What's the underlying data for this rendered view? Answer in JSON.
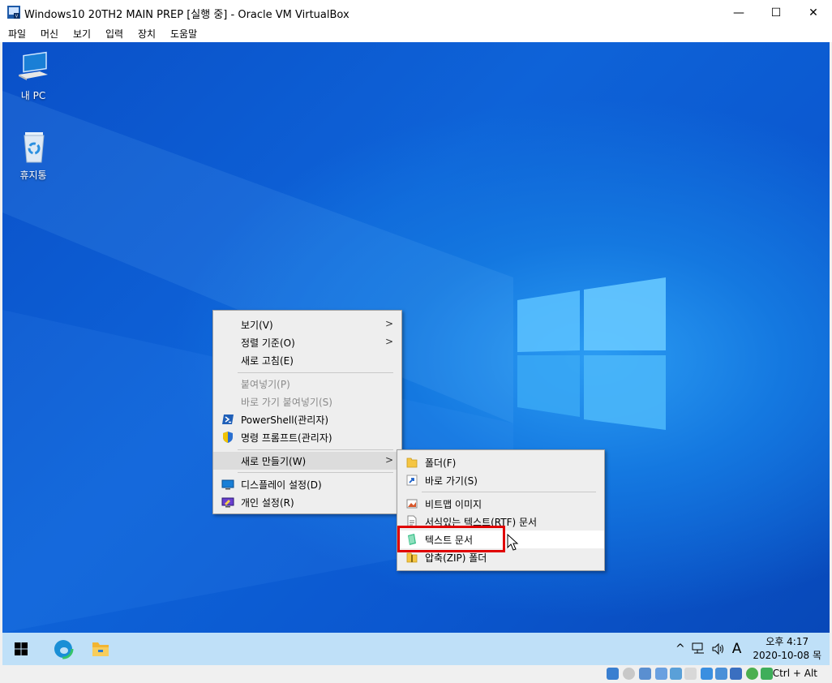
{
  "window": {
    "title": "Windows10 20TH2 MAIN PREP [실행 중] - Oracle VM VirtualBox",
    "minimize_glyph": "—",
    "maximize_glyph": "☐",
    "close_glyph": "✕"
  },
  "menubar": {
    "items": [
      "파일",
      "머신",
      "보기",
      "입력",
      "장치",
      "도움말"
    ]
  },
  "desktop": {
    "icons": [
      {
        "label": "내 PC",
        "icon": "this-pc-icon"
      },
      {
        "label": "휴지통",
        "icon": "recycle-bin-icon"
      }
    ]
  },
  "context_menu": {
    "items": [
      {
        "label": "보기(V)",
        "submenu": true,
        "disabled": false
      },
      {
        "label": "정렬 기준(O)",
        "submenu": true,
        "disabled": false
      },
      {
        "label": "새로 고침(E)",
        "submenu": false,
        "disabled": false
      },
      {
        "label": "붙여넣기(P)",
        "submenu": false,
        "disabled": true
      },
      {
        "label": "바로 가기 붙여넣기(S)",
        "submenu": false,
        "disabled": true
      },
      {
        "label": "PowerShell(관리자)",
        "icon": "powershell-icon",
        "disabled": false
      },
      {
        "label": "명령 프롬프트(관리자)",
        "icon": "shield-icon",
        "disabled": false
      },
      {
        "label": "새로 만들기(W)",
        "submenu": true,
        "disabled": false,
        "highlighted": true
      },
      {
        "label": "디스플레이 설정(D)",
        "icon": "display-icon",
        "disabled": false
      },
      {
        "label": "개인 설정(R)",
        "icon": "personalize-icon",
        "disabled": false
      }
    ],
    "submenu_arrow": ">"
  },
  "new_submenu": {
    "items": [
      {
        "label": "폴더(F)",
        "icon": "folder-icon"
      },
      {
        "label": "바로 가기(S)",
        "icon": "shortcut-icon"
      },
      {
        "label": "비트맵 이미지",
        "icon": "bitmap-icon"
      },
      {
        "label": "서식있는 텍스트(RTF) 문서",
        "icon": "rtf-icon"
      },
      {
        "label": "텍스트 문서",
        "icon": "text-doc-icon",
        "highlighted": true
      },
      {
        "label": "압축(ZIP) 폴더",
        "icon": "zip-folder-icon"
      }
    ]
  },
  "taskbar": {
    "tray": {
      "chevron": "^",
      "ime": "A"
    },
    "clock": {
      "time": "오후 4:17",
      "date": "2020-10-08 목"
    }
  },
  "statusbar": {
    "host_key": "Ctrl + Alt"
  },
  "colors": {
    "accent_red": "#e00000",
    "taskbar": "#bfe0f8",
    "desktop_blue": "#0e63d8"
  }
}
